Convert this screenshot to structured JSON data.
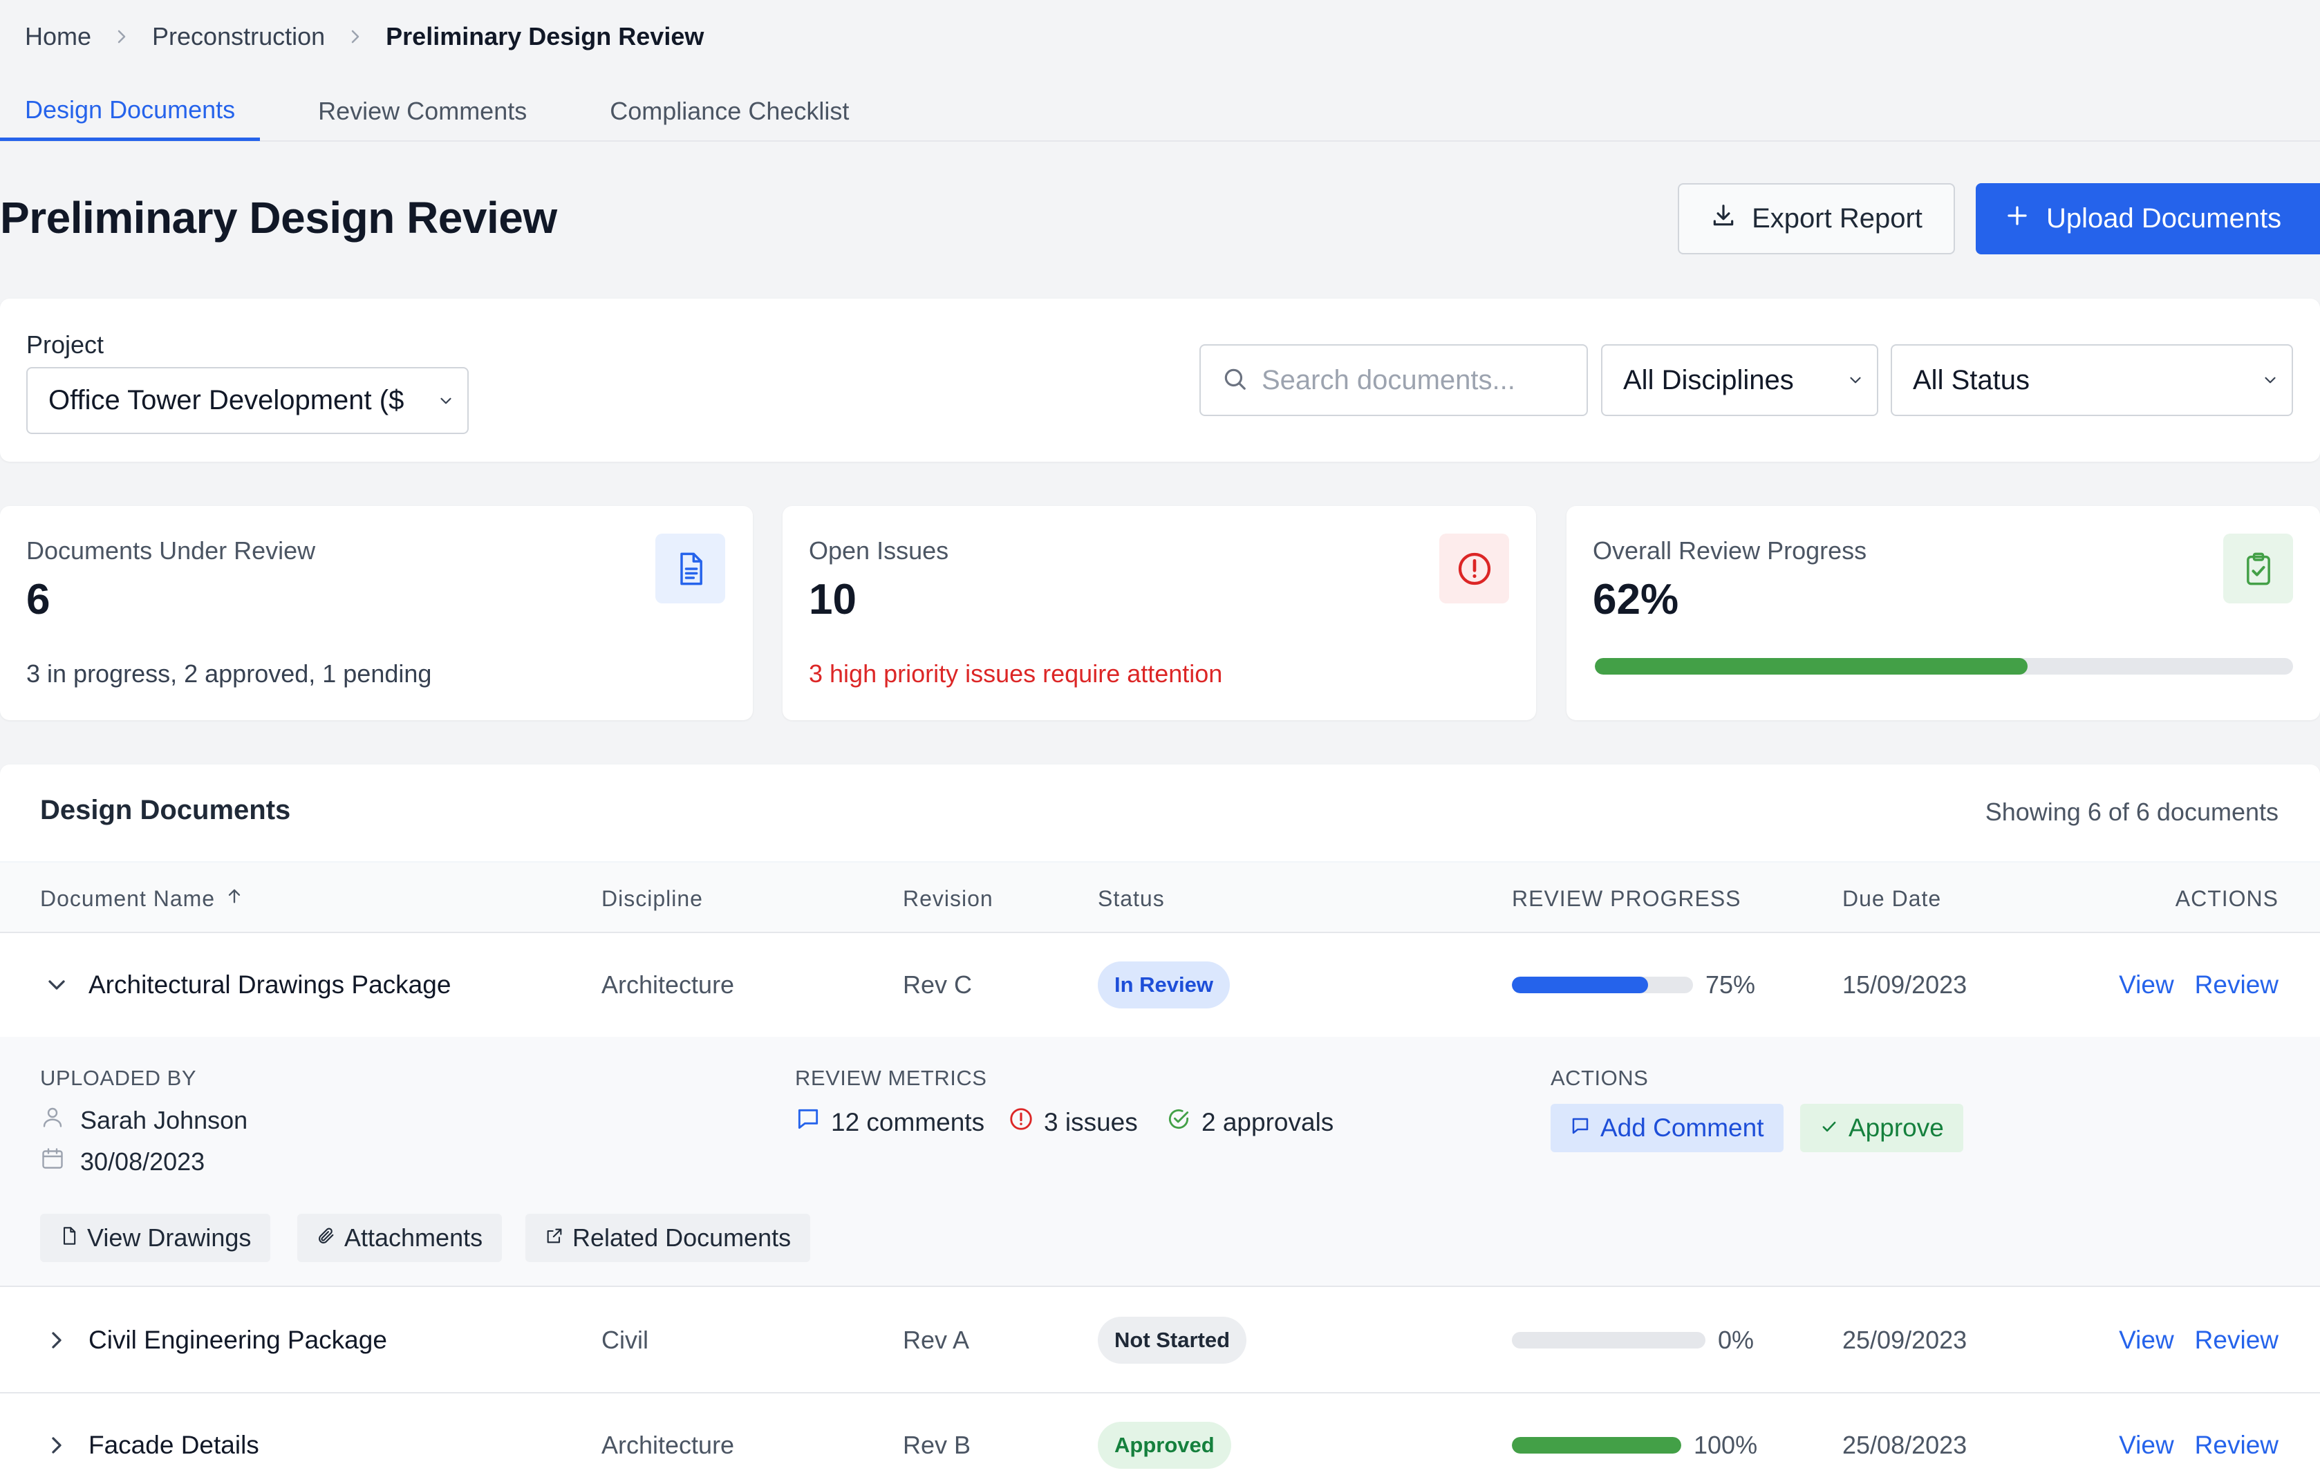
{
  "breadcrumb": {
    "items": [
      "Home",
      "Preconstruction"
    ],
    "current": "Preliminary Design Review"
  },
  "tabs": [
    "Design Documents",
    "Review Comments",
    "Compliance Checklist"
  ],
  "page_title": "Preliminary Design Review",
  "buttons": {
    "export": "Export Report",
    "upload": "Upload Documents"
  },
  "filters": {
    "project_label": "Project",
    "project_value": "Office Tower Development ($",
    "search_placeholder": "Search documents...",
    "discipline_value": "All Disciplines",
    "status_value": "All Status"
  },
  "stats": [
    {
      "label": "Documents Under Review",
      "value": "6",
      "sub": "3 in progress, 2 approved, 1 pending",
      "icon": "document-icon"
    },
    {
      "label": "Open Issues",
      "value": "10",
      "sub": "3 high priority issues require attention",
      "icon": "alert-circle-icon"
    },
    {
      "label": "Overall Review Progress",
      "value": "62%",
      "progress": 0.62,
      "icon": "clipboard-check-icon"
    }
  ],
  "documents_section": {
    "title": "Design Documents",
    "count_text": "Showing 6 of 6 documents",
    "columns": [
      "Document Name",
      "Discipline",
      "Revision",
      "Status",
      "REVIEW PROGRESS",
      "Due Date",
      "ACTIONS"
    ],
    "rows": [
      {
        "name": "Architectural Drawings Package",
        "discipline": "Architecture",
        "revision": "Rev C",
        "status": "In Review",
        "progress": 75,
        "progress_label": "75%",
        "due": "15/09/2023",
        "expanded": true
      },
      {
        "name": "Civil Engineering Package",
        "discipline": "Civil",
        "revision": "Rev A",
        "status": "Not Started",
        "progress": 0,
        "progress_label": "0%",
        "due": "25/09/2023",
        "expanded": false
      },
      {
        "name": "Facade Details",
        "discipline": "Architecture",
        "revision": "Rev B",
        "status": "Approved",
        "progress": 100,
        "progress_label": "100%",
        "due": "25/08/2023",
        "expanded": false
      }
    ],
    "row_actions": {
      "view": "View",
      "review": "Review"
    }
  },
  "expanded_detail": {
    "uploaded_by_label": "UPLOADED BY",
    "uploader": "Sarah Johnson",
    "upload_date": "30/08/2023",
    "metrics_label": "REVIEW METRICS",
    "comments": "12 comments",
    "issues": "3 issues",
    "approvals": "2 approvals",
    "actions_label": "ACTIONS",
    "add_comment": "Add Comment",
    "approve": "Approve",
    "links": [
      "View Drawings",
      "Attachments",
      "Related Documents"
    ]
  },
  "colors": {
    "accent": "#2563eb",
    "success": "#43a047",
    "danger": "#dc2626",
    "in_review_bg": "#dbe7fd",
    "in_review_text": "#1d4ed8",
    "not_started_bg": "#eceef1",
    "approved_bg": "#e3f4e6",
    "approved_text": "#15803d"
  }
}
